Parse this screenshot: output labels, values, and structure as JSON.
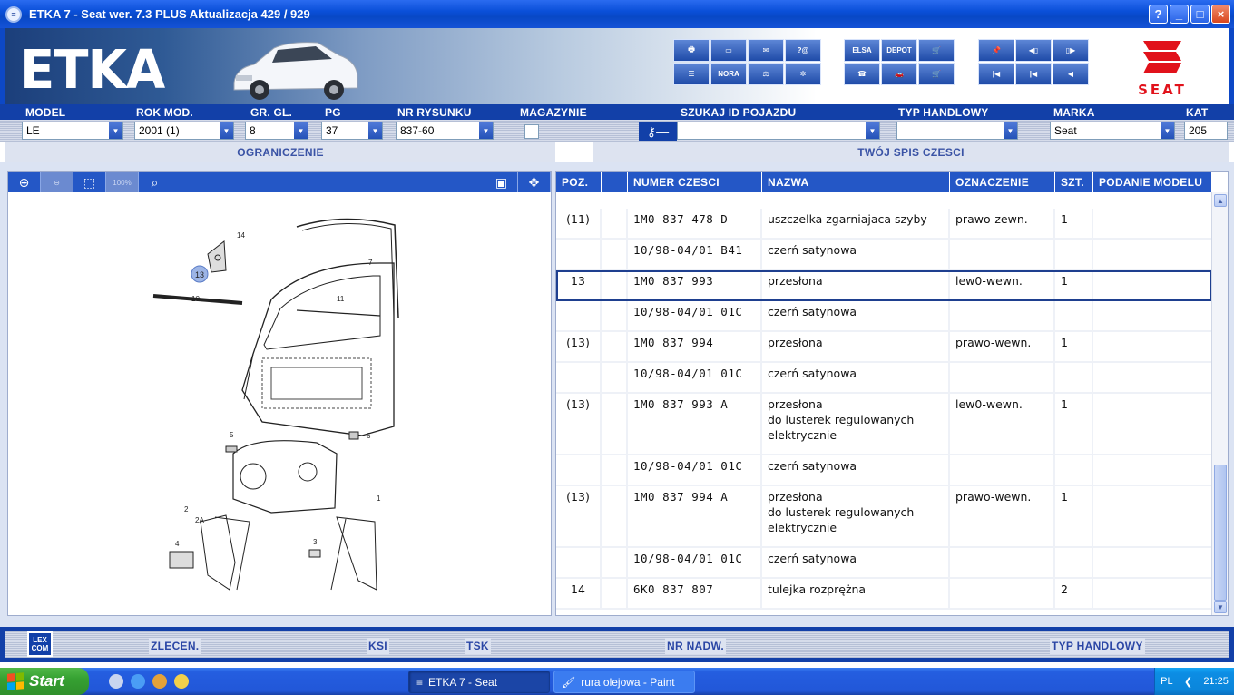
{
  "window": {
    "title": "ETKA 7 - Seat wer. 7.3 PLUS Aktualizacja 429 / 929",
    "help": "?",
    "minimize": "_",
    "maximize": "□",
    "close": "×"
  },
  "banner": {
    "logo": "ETKA",
    "toolbar_labels": {
      "elsa": "ELSA",
      "depot": "DEPOT",
      "nora": "NORA"
    },
    "brand": "SEAT"
  },
  "filters": {
    "model": {
      "label": "MODEL",
      "value": "LE"
    },
    "rok_mod": {
      "label": "ROK MOD.",
      "value": "2001 (1)"
    },
    "gr_gl": {
      "label": "GR. GL.",
      "value": "8"
    },
    "pg": {
      "label": "PG",
      "value": "37"
    },
    "nr_rysunku": {
      "label": "NR RYSUNKU",
      "value": "837-60"
    },
    "magazynie": {
      "label": "MAGAZYNIE"
    },
    "szukaj": {
      "label": "SZUKAJ ID POJAZDU",
      "value": ""
    },
    "typ_handlowy": {
      "label": "TYP HANDLOWY",
      "value": ""
    },
    "marka": {
      "label": "MARKA",
      "value": "Seat"
    },
    "kat": {
      "label": "KAT",
      "value": "205"
    }
  },
  "sections": {
    "left": "OGRANICZENIE",
    "right": "TWÓJ SPIS CZESCI"
  },
  "viewer_tools": {
    "zoom_100": "100%"
  },
  "drawing_callouts": [
    "14",
    "13",
    "7",
    "10",
    "11",
    "5",
    "6",
    "1",
    "2",
    "2A",
    "4",
    "3"
  ],
  "parts_table": {
    "columns": [
      "POZ.",
      "",
      "NUMER CZESCI",
      "NAZWA",
      "OZNACZENIE",
      "SZT.",
      "PODANIE MODELU"
    ],
    "rows": [
      {
        "poz": "(11)",
        "num": "1M0 837 478 D",
        "name": "uszczelka zgarniajaca szyby",
        "ozn": "prawo-zewn.",
        "szt": "1",
        "pod": ""
      },
      {
        "poz": "",
        "num": "10/98-04/01 B41",
        "name": "czerń satynowa",
        "ozn": "",
        "szt": "",
        "pod": ""
      },
      {
        "poz": "13",
        "num": "1M0 837 993",
        "name": "przesłona",
        "ozn": "lew0-wewn.",
        "szt": "1",
        "pod": ""
      },
      {
        "poz": "",
        "num": "10/98-04/01 01C",
        "name": "czerń satynowa",
        "ozn": "",
        "szt": "",
        "pod": ""
      },
      {
        "poz": "(13)",
        "num": "1M0 837 994",
        "name": "przesłona",
        "ozn": "prawo-wewn.",
        "szt": "1",
        "pod": ""
      },
      {
        "poz": "",
        "num": "10/98-04/01 01C",
        "name": "czerń satynowa",
        "ozn": "",
        "szt": "",
        "pod": ""
      },
      {
        "poz": "(13)",
        "num": "1M0 837 993 A",
        "name": "przesłona",
        "name2": "do lusterek regulowanych",
        "name3": "elektrycznie",
        "ozn": "lew0-wewn.",
        "szt": "1",
        "pod": ""
      },
      {
        "poz": "",
        "num": "10/98-04/01 01C",
        "name": "czerń satynowa",
        "ozn": "",
        "szt": "",
        "pod": ""
      },
      {
        "poz": "(13)",
        "num": "1M0 837 994 A",
        "name": "przesłona",
        "name2": "do lusterek regulowanych",
        "name3": "elektrycznie",
        "ozn": "prawo-wewn.",
        "szt": "1",
        "pod": ""
      },
      {
        "poz": "",
        "num": "10/98-04/01 01C",
        "name": "czerń satynowa",
        "ozn": "",
        "szt": "",
        "pod": ""
      },
      {
        "poz": "14",
        "num": "6K0 837 807",
        "name": "tulejka rozprężna",
        "ozn": "",
        "szt": "2",
        "pod": ""
      }
    ]
  },
  "bottom_bar": {
    "lexcom_top": "LEX",
    "lexcom_bottom": "COM",
    "zlecen": "ZLECEN.",
    "ksi": "KSI",
    "tsk": "TSK",
    "nr_nadw": "NR NADW.",
    "typ_handlowy": "TYP HANDLOWY"
  },
  "taskbar": {
    "start": "Start",
    "tasks": [
      "ETKA 7 - Seat",
      "rura olejowa - Paint"
    ],
    "lang": "PL",
    "clock": "21:25"
  }
}
